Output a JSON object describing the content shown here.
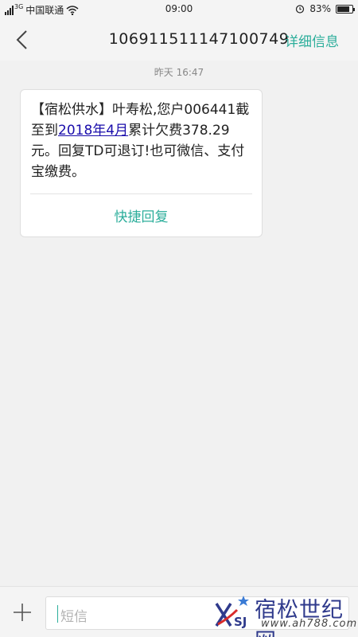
{
  "status_bar": {
    "network_type": "3G",
    "carrier": "中国联通",
    "time": "09:00",
    "battery": "83%",
    "battery_level": 0.83,
    "icons": [
      "signal-icon",
      "wifi-icon",
      "alarm-icon",
      "battery-icon"
    ]
  },
  "header": {
    "back_icon": "back-arrow-icon",
    "title": "106911511147100749",
    "detail_label": "详细信息"
  },
  "conversation": {
    "timestamp": "昨天  16:47",
    "message": {
      "part1": "【宿松供水】叶寿松,您户006441截至到",
      "link": "2018年4月",
      "part2": "累计欠费378.29元。回复TD可退订!也可微信、支付宝缴费。"
    },
    "quick_reply_label": "快捷回复"
  },
  "composer": {
    "plus_icon": "plus-icon",
    "placeholder": "短信"
  },
  "watermark": {
    "logo_text": "SJ",
    "site_name": "宿松世纪网",
    "url": "www.ah788.com"
  },
  "colors": {
    "accent": "#2cae9b",
    "link": "#1a0dab",
    "background": "#f1f1f1"
  }
}
